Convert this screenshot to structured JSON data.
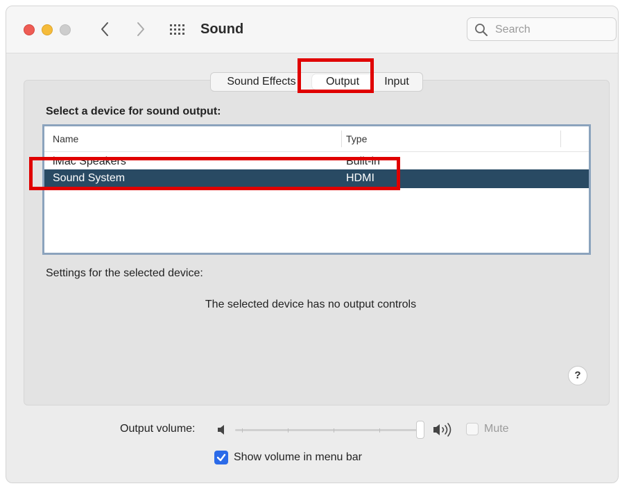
{
  "window": {
    "title": "Sound",
    "search": {
      "placeholder": "Search",
      "value": ""
    }
  },
  "tabs": [
    {
      "label": "Sound Effects",
      "selected": false
    },
    {
      "label": "Output",
      "selected": true
    },
    {
      "label": "Input",
      "selected": false
    }
  ],
  "output": {
    "section_label": "Select a device for sound output:",
    "columns": [
      "Name",
      "Type"
    ],
    "devices": [
      {
        "name": "iMac Speakers",
        "type": "Built-in",
        "selected": false
      },
      {
        "name": "Sound System",
        "type": "HDMI",
        "selected": true
      }
    ],
    "settings_label": "Settings for the selected device:",
    "no_controls_text": "The selected device has no output controls",
    "help_label": "?"
  },
  "volume": {
    "label": "Output volume:",
    "level": 1.0,
    "mute_label": "Mute",
    "mute_checked": false,
    "show_in_menu_bar_label": "Show volume in menu bar",
    "show_in_menu_bar_checked": true
  },
  "colors": {
    "selection": "#294a63",
    "highlight_box": "#e00000",
    "checkbox_accent": "#2b6ae8"
  }
}
